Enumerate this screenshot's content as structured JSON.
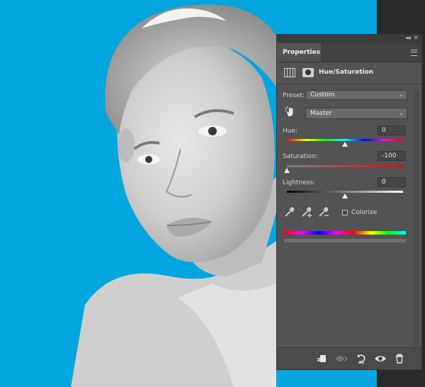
{
  "panel": {
    "tab_label": "Properties",
    "adjustment_title": "Hue/Saturation",
    "preset_label": "Preset:",
    "preset_value": "Custom",
    "channel_value": "Master",
    "hue_label": "Hue:",
    "hue_value": "0",
    "saturation_label": "Saturation:",
    "saturation_value": "-100",
    "lightness_label": "Lightness:",
    "lightness_value": "0",
    "colorize_label": "Colorize",
    "colorize_checked": false
  },
  "sliders": {
    "hue_level": 0.5,
    "saturation_level": 0.0,
    "lightness_level": 0.5
  },
  "icons": {
    "collapse": "double-chevron-left-icon",
    "close": "close-icon",
    "panel_menu": "hamburger-menu-icon",
    "adjustment": "hue-saturation-adjustment-icon",
    "mask": "layer-mask-icon",
    "targeted_adjustment": "hand-adjust-icon",
    "eyedropper": "eyedropper-icon",
    "eyedropper_add": "eyedropper-plus-icon",
    "eyedropper_subtract": "eyedropper-minus-icon",
    "clip": "clip-to-layer-icon",
    "view_previous": "view-previous-state-icon",
    "reset": "reset-icon",
    "visibility": "eye-icon",
    "delete": "trash-icon"
  },
  "colors": {
    "canvas_background": "#00a6dd",
    "panel_background": "#535353"
  }
}
